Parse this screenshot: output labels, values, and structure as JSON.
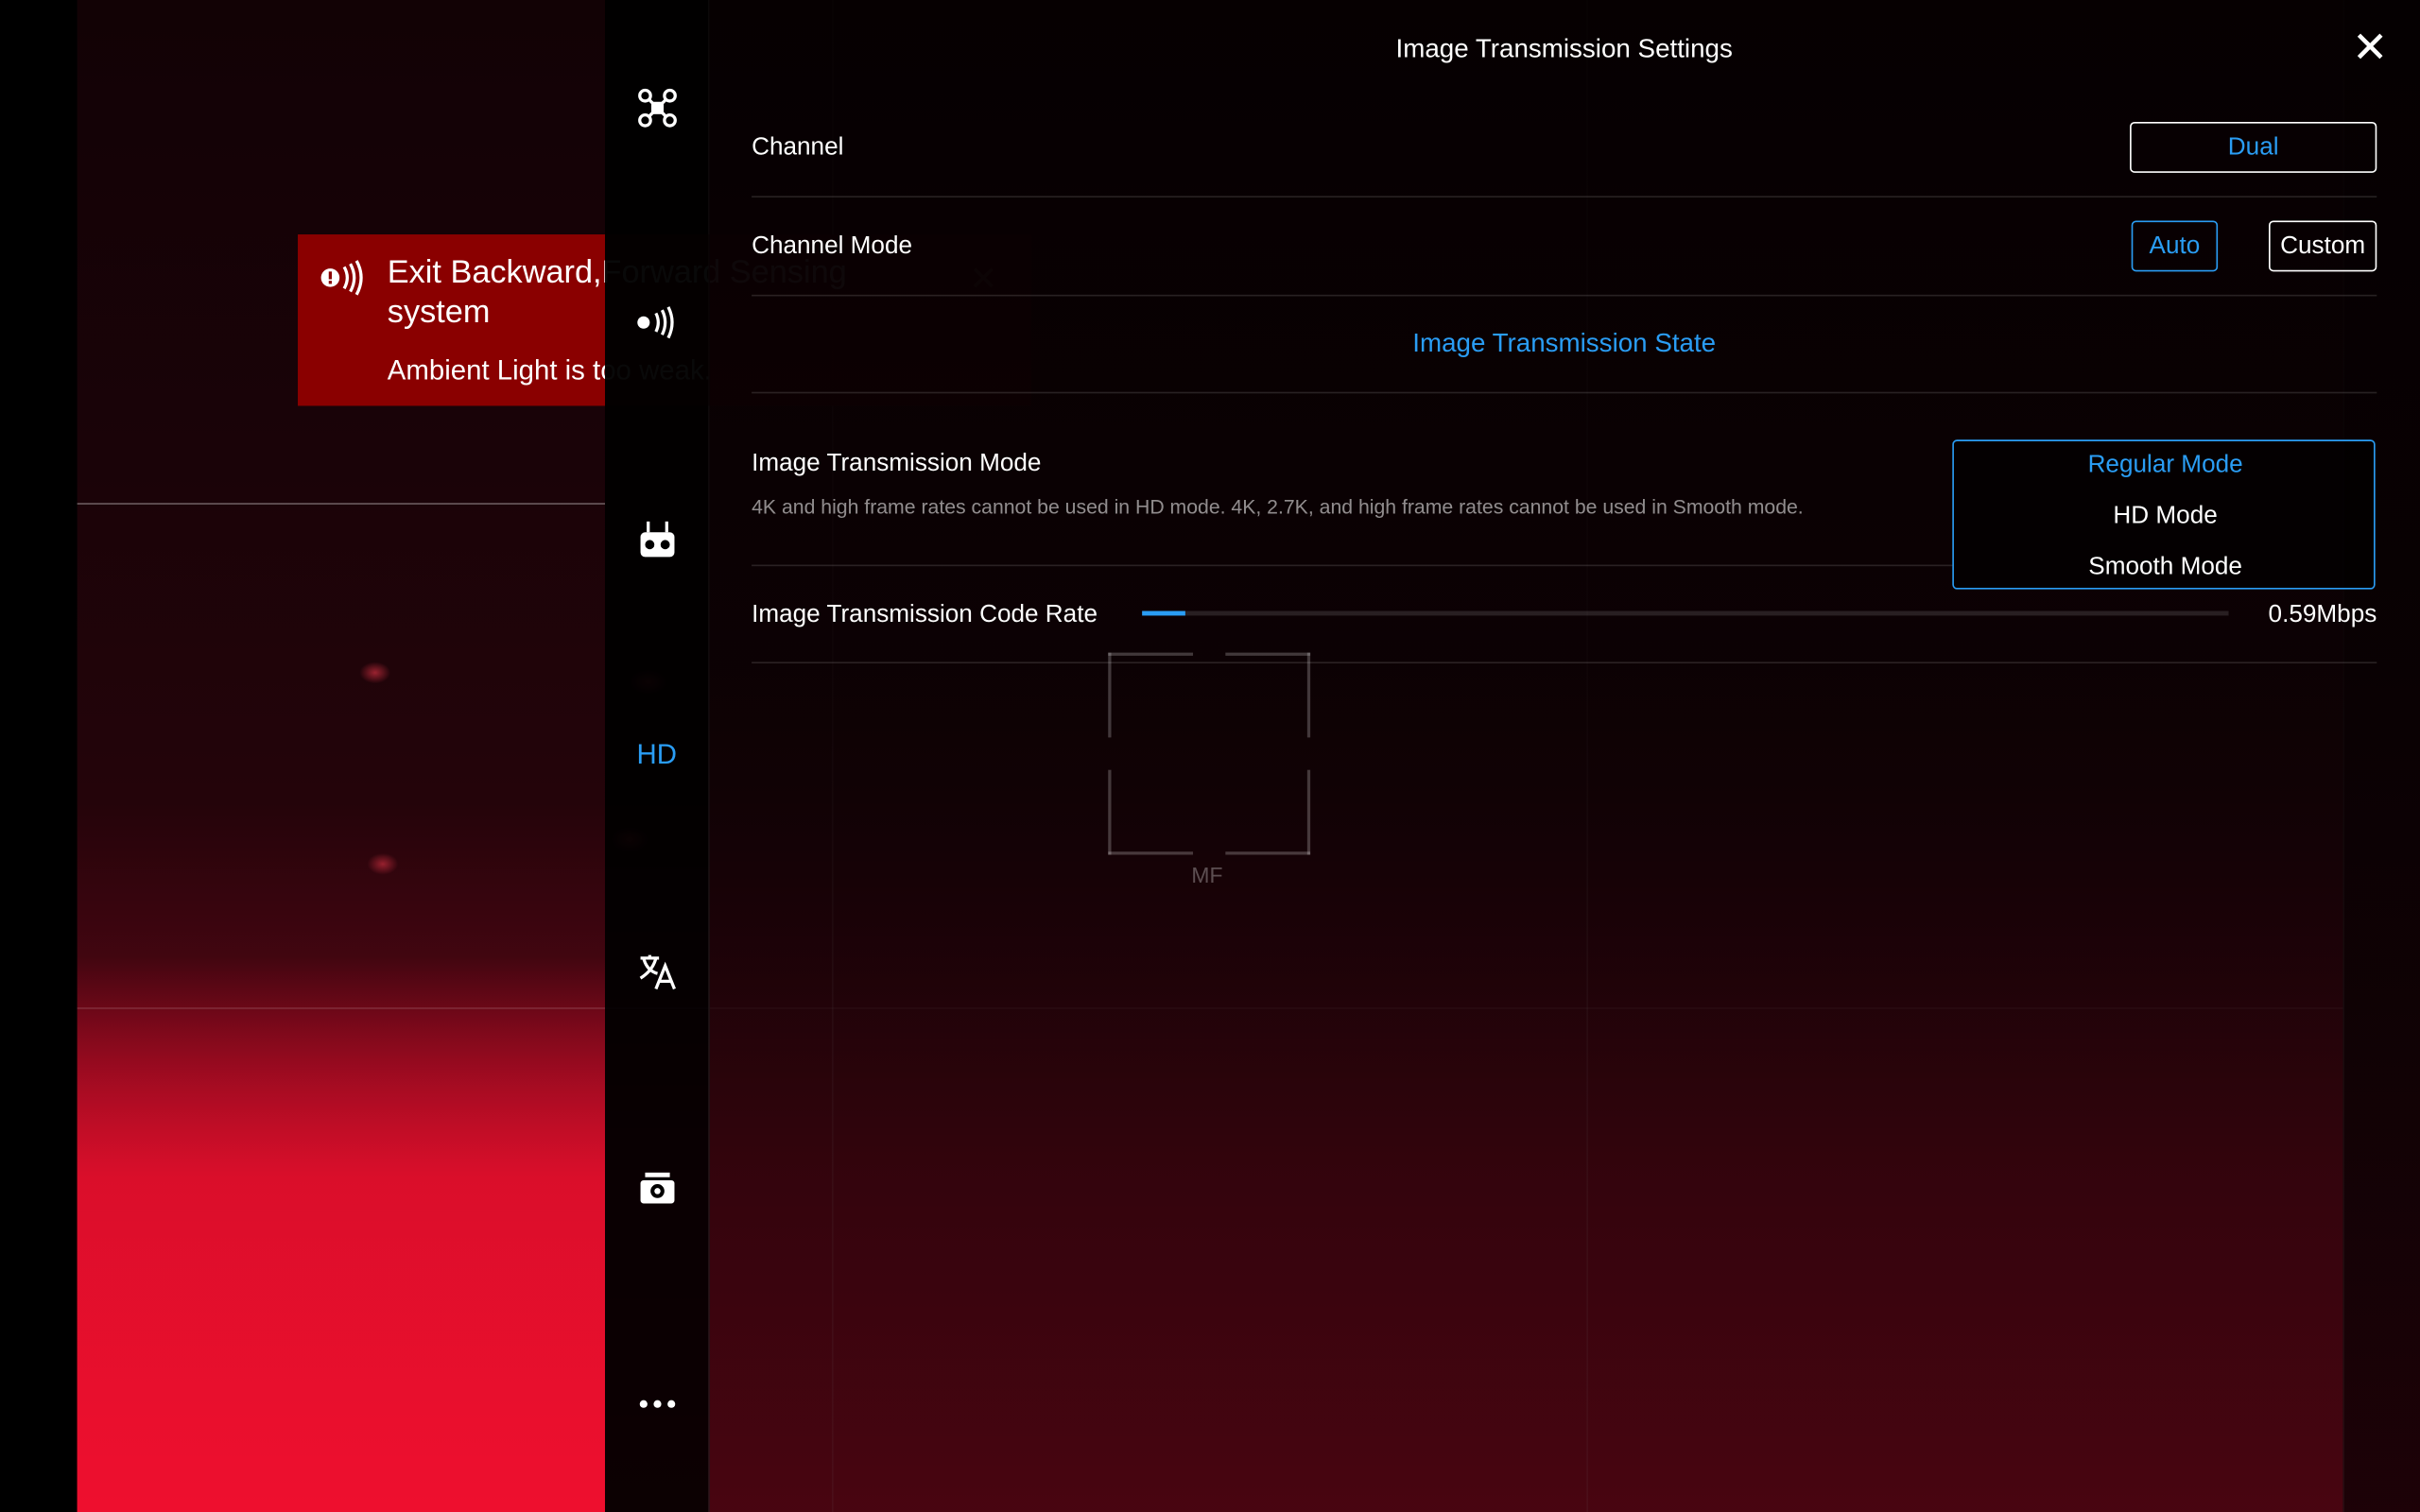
{
  "title": "Image Transmission Settings",
  "toast": {
    "title_line1": "Exit Backward,Forward Sensing",
    "title_line2": "system",
    "message": "Ambient Light is too weak."
  },
  "side_nav": {
    "active_label": "HD",
    "items": [
      "drone-icon",
      "sensor-icon",
      "remote-controller-icon",
      "HD",
      "translate-icon",
      "camera-icon",
      "more-icon"
    ]
  },
  "settings": {
    "channel": {
      "label": "Channel",
      "value": "Dual"
    },
    "channel_mode": {
      "label": "Channel Mode",
      "options": [
        "Auto",
        "Custom"
      ],
      "selected": "Auto"
    },
    "state_link": "Image Transmission State",
    "transmission_mode": {
      "label": "Image Transmission Mode",
      "hint": "4K and high frame rates cannot be used in HD mode. 4K, 2.7K, and high frame rates cannot be used in Smooth mode.",
      "options": [
        "Regular Mode",
        "HD Mode",
        "Smooth Mode"
      ],
      "selected": "Regular Mode"
    },
    "code_rate": {
      "label": "Image Transmission Code Rate",
      "value": "0.59Mbps",
      "fraction": 0.04
    }
  },
  "camera": {
    "focus_mode": "MF"
  },
  "colors": {
    "accent": "#2a9df4",
    "toast_bg": "#8a0000"
  }
}
